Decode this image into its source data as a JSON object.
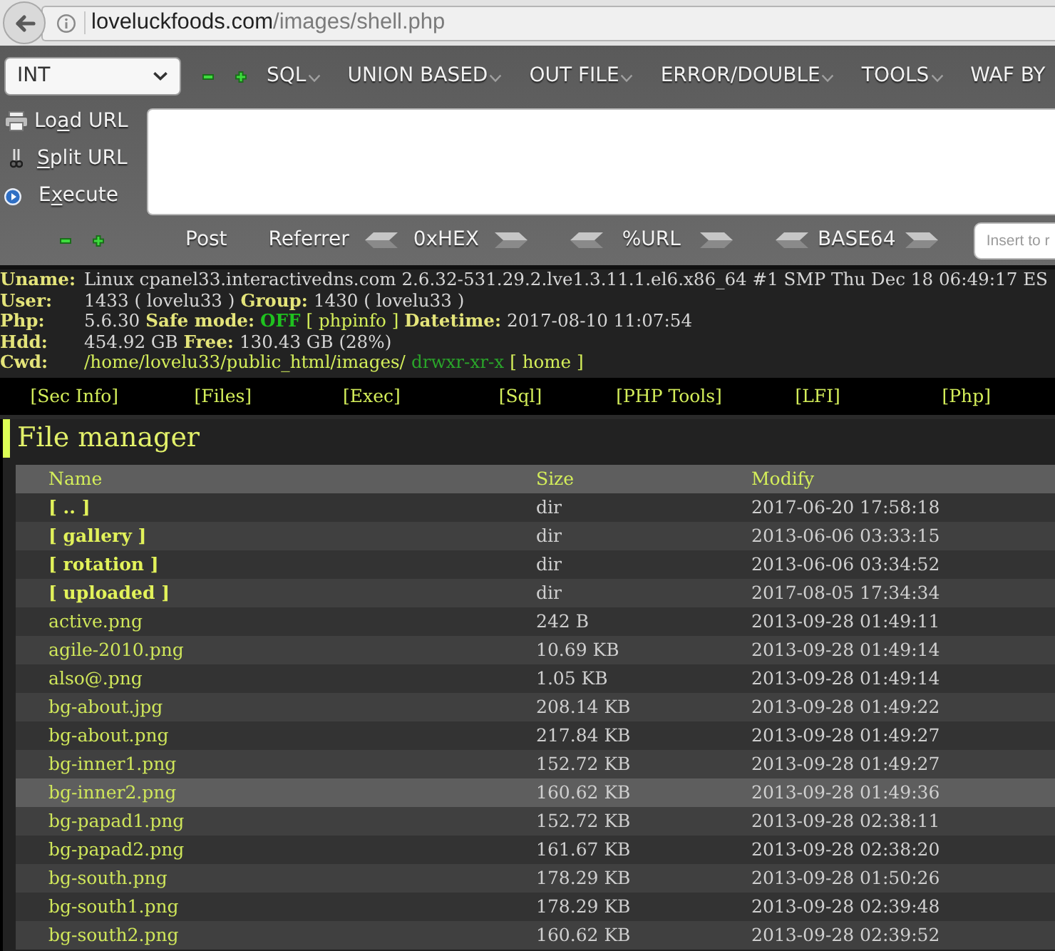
{
  "browser": {
    "url_host": "loveluckfoods.com",
    "url_path": "/images/shell.php"
  },
  "hackbar": {
    "mode_select": {
      "value": "INT"
    },
    "menus": [
      {
        "label": "SQL"
      },
      {
        "label": "UNION BASED"
      },
      {
        "label": "OUT FILE"
      },
      {
        "label": "ERROR/DOUBLE"
      },
      {
        "label": "TOOLS"
      },
      {
        "label": "WAF BY"
      }
    ],
    "actions": [
      {
        "kind": "load",
        "label": {
          "before": "Lo",
          "key": "a",
          "after": "d URL"
        }
      },
      {
        "kind": "split",
        "label": {
          "key": "S",
          "after": "plit URL"
        }
      },
      {
        "kind": "execute",
        "label": {
          "before": "E",
          "key": "x",
          "after": "ecute"
        }
      }
    ],
    "options": [
      {
        "kind": "toggle",
        "label": "Post"
      },
      {
        "kind": "toggle",
        "label": "Referrer"
      },
      {
        "kind": "encoder",
        "label": "0xHEX"
      },
      {
        "kind": "encoder",
        "label": "%URL"
      },
      {
        "kind": "encoder",
        "label": "BASE64"
      }
    ],
    "insert_field": {
      "placeholder": "Insert to r"
    }
  },
  "system_info": [
    {
      "label": "Uname:",
      "parts": [
        {
          "kind": "text",
          "text": "Linux cpanel33.interactivedns.com 2.6.32-531.29.2.lve1.3.11.1.el6.x86_64 #1 SMP Thu Dec 18 06:49:17 ES"
        }
      ]
    },
    {
      "label": "User:",
      "parts": [
        {
          "kind": "text",
          "text": "1433 ( lovelu33 )"
        },
        {
          "kind": "label",
          "text": "Group:"
        },
        {
          "kind": "text",
          "text": "1430 ( lovelu33 )"
        }
      ]
    },
    {
      "label": "Php:",
      "parts": [
        {
          "kind": "text",
          "text": "5.6.30"
        },
        {
          "kind": "label",
          "text": "Safe mode:"
        },
        {
          "kind": "status",
          "text": "OFF"
        },
        {
          "kind": "link",
          "text": "[ phpinfo ]"
        },
        {
          "kind": "label",
          "text": "Datetime:"
        },
        {
          "kind": "text",
          "text": "2017-08-10 11:07:54"
        }
      ]
    },
    {
      "label": "Hdd:",
      "parts": [
        {
          "kind": "text",
          "text": "454.92 GB"
        },
        {
          "kind": "label",
          "text": "Free:"
        },
        {
          "kind": "text",
          "text": "130.43 GB (28%)"
        }
      ]
    },
    {
      "label": "Cwd:",
      "parts": [
        {
          "kind": "path",
          "text": "/home/lovelu33/public_html/images/"
        },
        {
          "kind": "permissions",
          "text": "drwxr-xr-x"
        },
        {
          "kind": "link",
          "text": "[ home ]"
        }
      ]
    }
  ],
  "nav": [
    "[Sec Info]",
    "[Files]",
    "[Exec]",
    "[Sql]",
    "[PHP Tools]",
    "[LFI]",
    "[Php]"
  ],
  "file_manager": {
    "title": "File manager",
    "columns": [
      "Name",
      "Size",
      "Modify"
    ],
    "rows": [
      {
        "kind": "dir",
        "name": "[ .. ]",
        "size": "dir",
        "modified": "2017-06-20 17:58:18",
        "highlighted": false
      },
      {
        "kind": "dir",
        "name": "[ gallery ]",
        "size": "dir",
        "modified": "2013-06-06 03:33:15",
        "highlighted": false
      },
      {
        "kind": "dir",
        "name": "[ rotation ]",
        "size": "dir",
        "modified": "2013-06-06 03:34:52",
        "highlighted": false
      },
      {
        "kind": "dir",
        "name": "[ uploaded ]",
        "size": "dir",
        "modified": "2017-08-05 17:34:34",
        "highlighted": false
      },
      {
        "kind": "file",
        "name": "active.png",
        "size": "242 B",
        "modified": "2013-09-28 01:49:11",
        "highlighted": false
      },
      {
        "kind": "file",
        "name": "agile-2010.png",
        "size": "10.69 KB",
        "modified": "2013-09-28 01:49:14",
        "highlighted": false
      },
      {
        "kind": "file",
        "name": "also@.png",
        "size": "1.05 KB",
        "modified": "2013-09-28 01:49:14",
        "highlighted": false
      },
      {
        "kind": "file",
        "name": "bg-about.jpg",
        "size": "208.14 KB",
        "modified": "2013-09-28 01:49:22",
        "highlighted": false
      },
      {
        "kind": "file",
        "name": "bg-about.png",
        "size": "217.84 KB",
        "modified": "2013-09-28 01:49:27",
        "highlighted": false
      },
      {
        "kind": "file",
        "name": "bg-inner1.png",
        "size": "152.72 KB",
        "modified": "2013-09-28 01:49:27",
        "highlighted": false
      },
      {
        "kind": "file",
        "name": "bg-inner2.png",
        "size": "160.62 KB",
        "modified": "2013-09-28 01:49:36",
        "highlighted": true
      },
      {
        "kind": "file",
        "name": "bg-papad1.png",
        "size": "152.72 KB",
        "modified": "2013-09-28 02:38:11",
        "highlighted": false
      },
      {
        "kind": "file",
        "name": "bg-papad2.png",
        "size": "161.67 KB",
        "modified": "2013-09-28 02:38:20",
        "highlighted": false
      },
      {
        "kind": "file",
        "name": "bg-south.png",
        "size": "178.29 KB",
        "modified": "2013-09-28 01:50:26",
        "highlighted": false
      },
      {
        "kind": "file",
        "name": "bg-south1.png",
        "size": "178.29 KB",
        "modified": "2013-09-28 02:39:48",
        "highlighted": false
      },
      {
        "kind": "file",
        "name": "bg-south2.png",
        "size": "160.62 KB",
        "modified": "2013-09-28 02:39:52",
        "highlighted": false
      }
    ]
  }
}
